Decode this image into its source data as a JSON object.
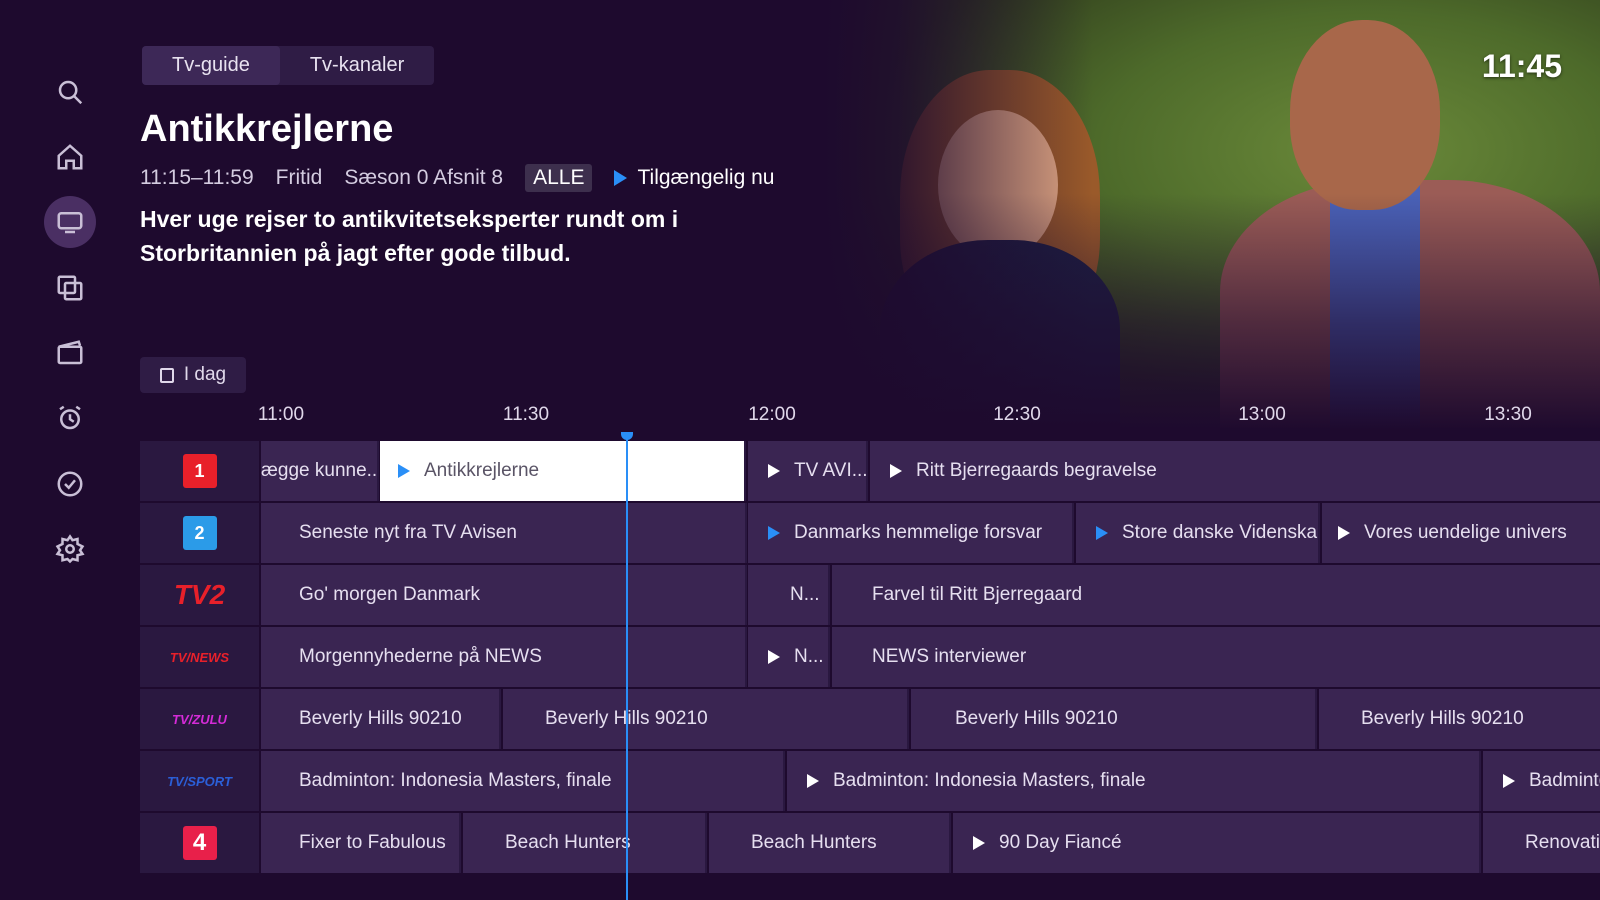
{
  "clock": "11:45",
  "tabs": [
    {
      "label": "Tv-guide",
      "active": true
    },
    {
      "label": "Tv-kanaler",
      "active": false
    }
  ],
  "sidebar": [
    {
      "icon": "search-icon"
    },
    {
      "icon": "home-icon"
    },
    {
      "icon": "tv-icon",
      "active": true
    },
    {
      "icon": "library-icon"
    },
    {
      "icon": "movie-icon"
    },
    {
      "icon": "alarm-icon"
    },
    {
      "icon": "check-icon"
    },
    {
      "icon": "settings-icon"
    }
  ],
  "program": {
    "title": "Antikkrejlerne",
    "time": "11:15–11:59",
    "genre": "Fritid",
    "episode": "Sæson 0 Afsnit 8",
    "rating": "ALLE",
    "availability": "Tilgængelig nu",
    "description": "Hver uge rejser to antikvitetseksperter rundt om i Storbritannien på jagt efter gode tilbud."
  },
  "date_button": "I dag",
  "timeline": [
    "11:00",
    "11:30",
    "12:00",
    "12:30",
    "13:00",
    "13:30"
  ],
  "channels": [
    {
      "logo": "dr1-logo",
      "logo_text": "1",
      "logo_color": "#e8202a",
      "programs": [
        {
          "title": "ægge kunne...",
          "play": null
        },
        {
          "title": "Antikkrejlerne",
          "play": "blue",
          "selected": true
        },
        {
          "title": "TV AVI...",
          "play": "white"
        },
        {
          "title": "Ritt Bjerregaards begravelse",
          "play": "white"
        }
      ]
    },
    {
      "logo": "dr2-logo",
      "logo_text": "2",
      "logo_color": "#2b9be8",
      "programs": [
        {
          "title": "Seneste nyt fra TV Avisen",
          "play": null
        },
        {
          "title": "Danmarks hemmelige forsvar",
          "play": "blue"
        },
        {
          "title": "Store danske Videnskabsfolk",
          "play": "blue"
        },
        {
          "title": "Vores uendelige univers",
          "play": "white"
        }
      ]
    },
    {
      "logo": "tv2-logo",
      "logo_text": "TV2",
      "logo_color": "#e8202a",
      "programs": [
        {
          "title": "Go' morgen Danmark",
          "play": null
        },
        {
          "title": "N...",
          "play": null
        },
        {
          "title": "Farvel til Ritt Bjerregaard",
          "play": null
        }
      ]
    },
    {
      "logo": "tv2-news-logo",
      "logo_text": "TV/NEWS",
      "logo_color": "#e8202a",
      "programs": [
        {
          "title": "Morgennyhederne på NEWS",
          "play": null
        },
        {
          "title": "N...",
          "play": "white"
        },
        {
          "title": "NEWS interviewer",
          "play": null
        }
      ]
    },
    {
      "logo": "tv2-zulu-logo",
      "logo_text": "TV/ZULU",
      "logo_color": "#d52bd8",
      "programs": [
        {
          "title": "Beverly Hills 90210",
          "play": null
        },
        {
          "title": "Beverly Hills 90210",
          "play": null
        },
        {
          "title": "Beverly Hills 90210",
          "play": null
        },
        {
          "title": "Beverly Hills 90210",
          "play": null
        }
      ]
    },
    {
      "logo": "tv2-sport-logo",
      "logo_text": "TV/SPORT",
      "logo_color": "#2b5fd8",
      "programs": [
        {
          "title": "Badminton: Indonesia Masters, finale",
          "play": null
        },
        {
          "title": "Badminton: Indonesia Masters, finale",
          "play": "white"
        },
        {
          "title": "Badminton",
          "play": "white"
        }
      ]
    },
    {
      "logo": "tv4-logo",
      "logo_text": "4",
      "logo_color": "#e8204a",
      "programs": [
        {
          "title": "Fixer to Fabulous",
          "play": null
        },
        {
          "title": "Beach Hunters",
          "play": null
        },
        {
          "title": "Beach Hunters",
          "play": null
        },
        {
          "title": "90 Day Fiancé",
          "play": "white"
        },
        {
          "title": "Renovation",
          "play": null
        }
      ]
    }
  ]
}
